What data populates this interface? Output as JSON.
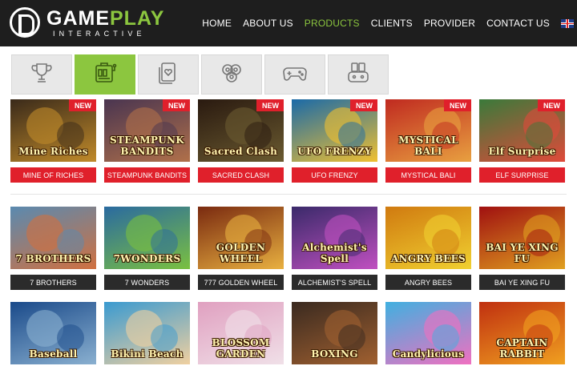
{
  "brand": {
    "game": "GAME",
    "play": "PLAY",
    "sub": "INTERACTIVE"
  },
  "nav": [
    {
      "label": "HOME",
      "active": false
    },
    {
      "label": "ABOUT US",
      "active": false
    },
    {
      "label": "PRODUCTS",
      "active": true
    },
    {
      "label": "CLIENTS",
      "active": false
    },
    {
      "label": "PROVIDER",
      "active": false
    },
    {
      "label": "CONTACT US",
      "active": false
    }
  ],
  "language_icon": "uk-flag-icon",
  "tabs": [
    {
      "icon": "trophy-icon",
      "active": false
    },
    {
      "icon": "slot-machine-icon",
      "active": true
    },
    {
      "icon": "playing-cards-icon",
      "active": false
    },
    {
      "icon": "casino-chips-icon",
      "active": false
    },
    {
      "icon": "gamepad-icon",
      "active": false
    },
    {
      "icon": "table-games-icon",
      "active": false
    }
  ],
  "badge_text": "NEW",
  "new_games": [
    {
      "name": "MINE OF RICHES",
      "art": "Mine Riches",
      "bg": [
        "#3a2a1a",
        "#c08a2a"
      ]
    },
    {
      "name": "STEAMPUNK BANDITS",
      "art": "STEAMPUNK BANDITS",
      "bg": [
        "#4a3550",
        "#b0704a"
      ]
    },
    {
      "name": "SACRED CLASH",
      "art": "Sacred Clash",
      "bg": [
        "#2a1a10",
        "#6a5a30"
      ]
    },
    {
      "name": "UFO FRENZY",
      "art": "UFO FRENZY",
      "bg": [
        "#1a6aa8",
        "#f0c030"
      ]
    },
    {
      "name": "MYSTICAL BALI",
      "art": "MYSTICAL BALI",
      "bg": [
        "#c02a20",
        "#e8a040"
      ]
    },
    {
      "name": "ELF SURPRISE",
      "art": "Elf Surprise",
      "bg": [
        "#3a7a3a",
        "#e04a3a"
      ]
    }
  ],
  "games_row2": [
    {
      "name": "7 BROTHERS",
      "art": "7 BROTHERS",
      "bg": [
        "#5a8ab0",
        "#d07040"
      ]
    },
    {
      "name": "7 WONDERS",
      "art": "7WONDERS",
      "bg": [
        "#2a6aa0",
        "#7ac040"
      ]
    },
    {
      "name": "777 GOLDEN WHEEL",
      "art": "GOLDEN WHEEL",
      "bg": [
        "#7a2a10",
        "#e8b040"
      ]
    },
    {
      "name": "ALCHEMIST'S SPELL",
      "art": "Alchemist's Spell",
      "bg": [
        "#3a2a6a",
        "#c050c0"
      ]
    },
    {
      "name": "ANGRY BEES",
      "art": "ANGRY BEES",
      "bg": [
        "#d07a10",
        "#f0d030"
      ]
    },
    {
      "name": "BAI YE XING FU",
      "art": "BAI YE XING FU",
      "bg": [
        "#a01010",
        "#e0a020"
      ]
    }
  ],
  "games_row3": [
    {
      "art": "Baseball",
      "bg": [
        "#1a4a8a",
        "#8ab0d0"
      ]
    },
    {
      "art": "Bikini Beach",
      "bg": [
        "#3a9ad0",
        "#f0d0a0"
      ]
    },
    {
      "art": "BLOSSOM GARDEN",
      "bg": [
        "#e0a0c0",
        "#f0e0e8"
      ]
    },
    {
      "art": "BOXING",
      "bg": [
        "#3a2a20",
        "#a06030"
      ]
    },
    {
      "art": "Candylicious",
      "bg": [
        "#40b0e0",
        "#f070c0"
      ]
    },
    {
      "art": "CAPTAIN RABBIT",
      "bg": [
        "#c03010",
        "#f0a020"
      ]
    }
  ]
}
